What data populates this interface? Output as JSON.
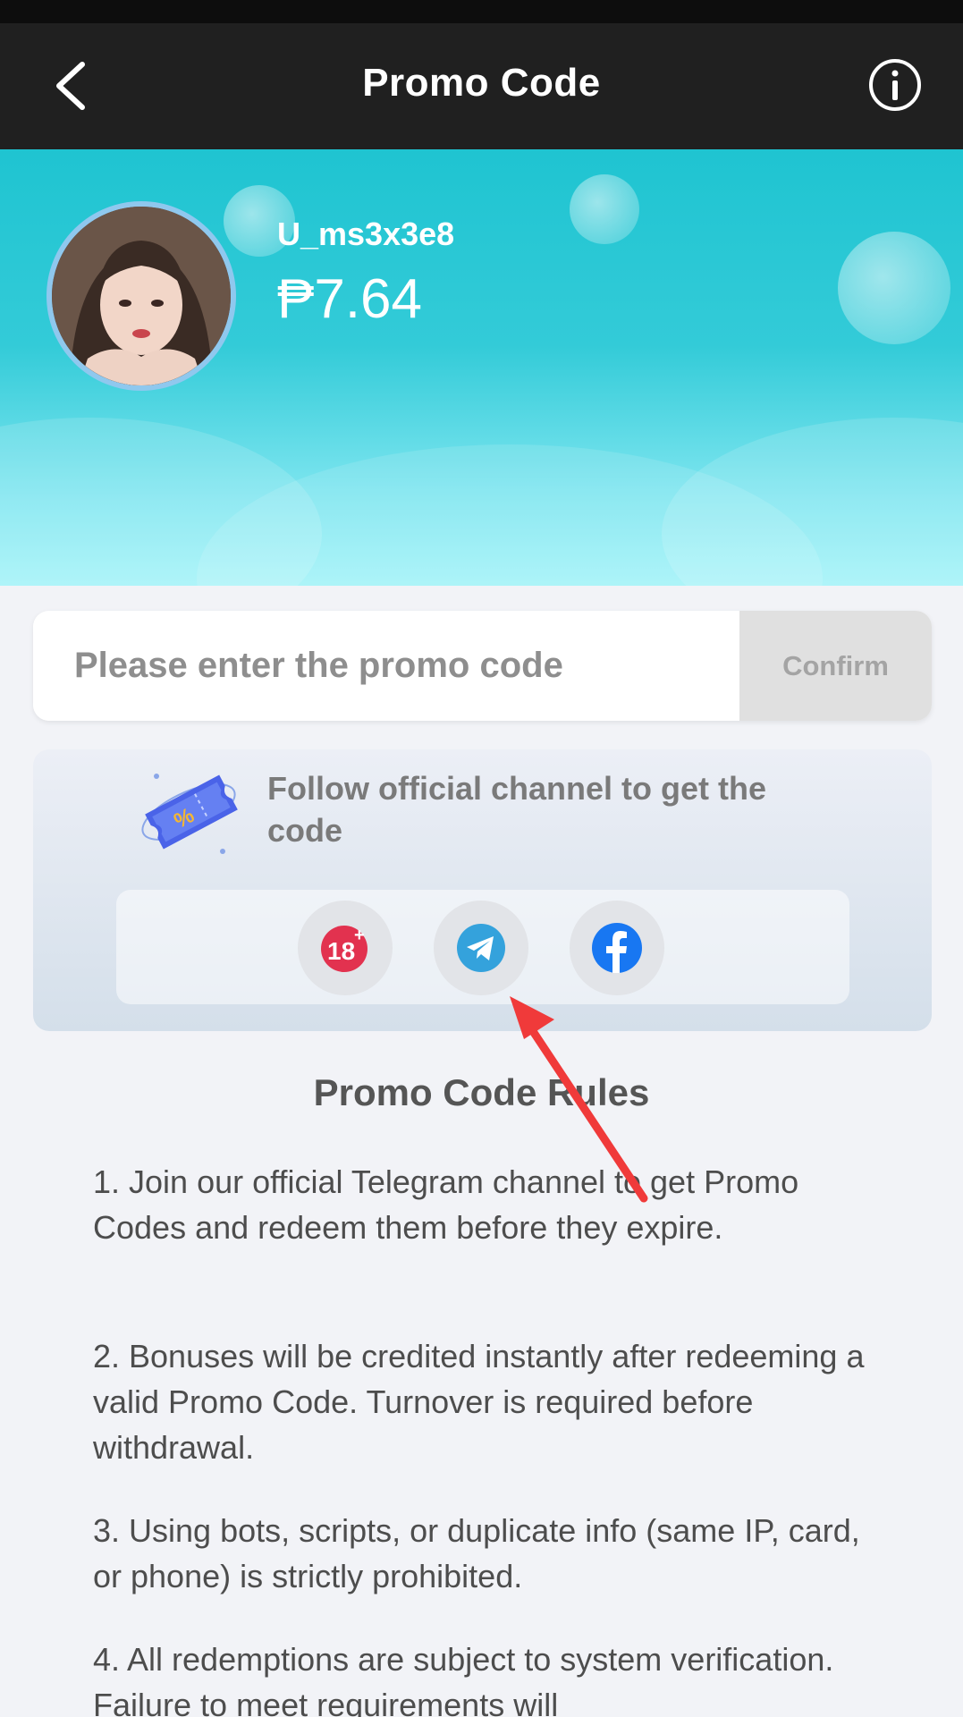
{
  "header": {
    "title": "Promo Code",
    "back_icon": "chevron-left-icon",
    "info_icon": "info-circle-icon"
  },
  "user": {
    "username": "U_ms3x3e8",
    "balance": "₱7.64"
  },
  "promo": {
    "placeholder": "Please enter the promo code",
    "confirm_label": "Confirm"
  },
  "follow": {
    "text": "Follow official channel to get the code",
    "channels": [
      {
        "name": "18+",
        "icon": "eighteen-plus-icon"
      },
      {
        "name": "Telegram",
        "icon": "telegram-icon"
      },
      {
        "name": "Facebook",
        "icon": "facebook-icon"
      }
    ]
  },
  "rules": {
    "title": "Promo Code Rules",
    "items": [
      "1. Join our official Telegram channel to get Promo Codes and redeem them before they expire.",
      "2. Bonuses will be credited instantly after redeeming a valid Promo Code. Turnover is required before withdrawal.",
      "3. Using bots, scripts, or duplicate info (same IP, card, or phone) is strictly prohibited.",
      "4. All redemptions are subject to system verification. Failure to meet requirements will"
    ]
  },
  "colors": {
    "header_bg": "#202020",
    "banner_top": "#1fc4d1",
    "banner_bottom": "#a2f3f8",
    "confirm_bg": "#e0e0e0",
    "annotation_arrow": "#f03a3a"
  }
}
